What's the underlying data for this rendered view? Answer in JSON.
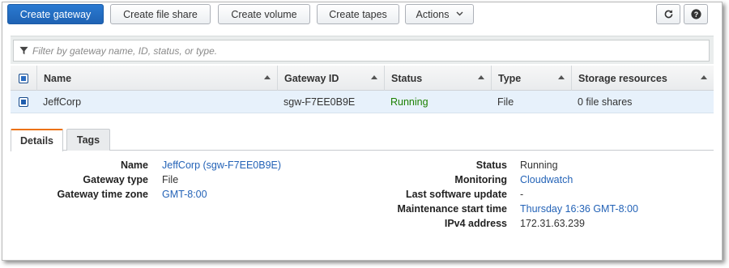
{
  "toolbar": {
    "create_gateway": "Create gateway",
    "create_file_share": "Create file share",
    "create_volume": "Create volume",
    "create_tapes": "Create tapes",
    "actions": "Actions",
    "refresh_icon": "refresh-icon",
    "help_icon": "help-icon"
  },
  "filter": {
    "placeholder": "Filter by gateway name, ID, status, or type."
  },
  "table": {
    "columns": [
      "Name",
      "Gateway ID",
      "Status",
      "Type",
      "Storage resources"
    ],
    "rows": [
      {
        "name": "JeffCorp",
        "gateway_id": "sgw-F7EE0B9E",
        "status": "Running",
        "type": "File",
        "storage": "0 file shares"
      }
    ]
  },
  "tabs": [
    "Details",
    "Tags"
  ],
  "details": {
    "left": [
      {
        "label": "Name",
        "value": "JeffCorp (sgw-F7EE0B9E)"
      },
      {
        "label": "Gateway type",
        "value": "File"
      },
      {
        "label": "Gateway time zone",
        "value": "GMT-8:00"
      }
    ],
    "right": [
      {
        "label": "Status",
        "value": "Running"
      },
      {
        "label": "Monitoring",
        "value": "Cloudwatch"
      },
      {
        "label": "Last software update",
        "value": "-"
      },
      {
        "label": "Maintenance start time",
        "value": "Thursday 16:36 GMT-8:00"
      },
      {
        "label": "IPv4 address",
        "value": "172.31.63.239"
      }
    ]
  },
  "colors": {
    "primary": "#1f63b4",
    "status_running": "#1d8102",
    "link": "#2463b7",
    "active_tab_accent": "#ec7211",
    "selected_row": "#e7f1fb"
  }
}
